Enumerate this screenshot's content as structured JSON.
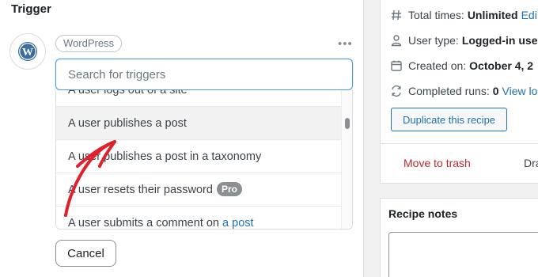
{
  "trigger": {
    "title": "Trigger",
    "integration_tag": "WordPress",
    "search_placeholder": "Search for triggers",
    "options": [
      {
        "label": "A user logs out of a site"
      },
      {
        "label": "A user publishes a post",
        "highlighted": true
      },
      {
        "label": "A user publishes a post in a taxonomy"
      },
      {
        "label": "A user resets their password",
        "badge": "Pro"
      },
      {
        "label_prefix": "A user submits a comment on ",
        "link_text": "a post"
      }
    ],
    "cancel_label": "Cancel"
  },
  "recipe_meta": {
    "total_times_label": "Total times:",
    "total_times_value": "Unlimited",
    "total_times_edit": "Edi",
    "user_type_label": "User type:",
    "user_type_value": "Logged-in use",
    "created_label": "Created on:",
    "created_value": "October 4, 2",
    "completed_label": "Completed runs:",
    "completed_value": "0",
    "completed_link": "View lo",
    "duplicate_label": "Duplicate this recipe",
    "trash_label": "Move to trash",
    "draft_label": "Dra"
  },
  "notes": {
    "title": "Recipe notes"
  },
  "colors": {
    "accent": "#2271b1",
    "danger": "#b32d2e",
    "annotation_arrow": "#e0202a"
  },
  "icons": [
    "wordpress-icon",
    "more-options-icon",
    "hash-icon",
    "user-icon",
    "calendar-icon",
    "refresh-icon"
  ]
}
